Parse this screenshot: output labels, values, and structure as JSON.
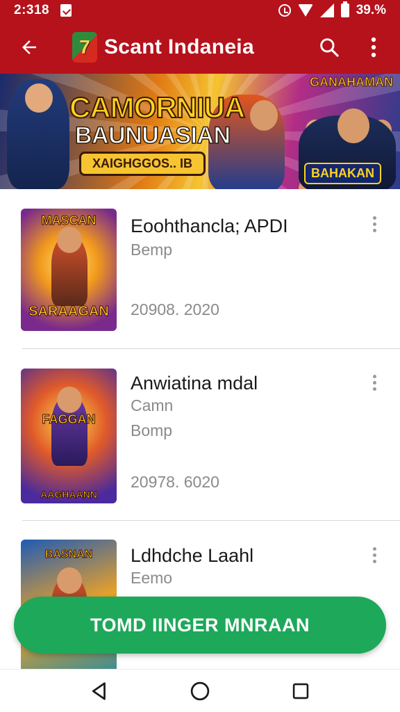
{
  "status_bar": {
    "time": "2:318",
    "battery": "39.%",
    "icons": [
      "notification-icon",
      "alarm-icon",
      "wifi-icon",
      "signal-icon",
      "battery-icon"
    ]
  },
  "app_bar": {
    "title": "Scant Indaneia",
    "logo_glyph": "7",
    "background": "#b5121b",
    "icons": [
      "back-arrow-icon",
      "search-icon",
      "more-vert-icon"
    ]
  },
  "banner": {
    "title": "CAMORNIUA",
    "subtitle": "BAUNUASIAN",
    "tag": "XAIGHGGOS.. IB",
    "logo_top": "GANAHAMAN",
    "logo_bottom": "BAHAKAN"
  },
  "items": [
    {
      "title": "Eoohthancla; APDI",
      "subtitle": "Bemp",
      "date": "20908. 2020",
      "thumb_top": "MASCAN",
      "thumb_bottom": "SARAAGAN"
    },
    {
      "title": "Anwiatina mdal",
      "subtitle": "Camn",
      "subtitle2": "Bomp",
      "date": "20978. 6020",
      "thumb_top": "FAGGAN",
      "thumb_bottom": "AAGHAANN"
    },
    {
      "title": "Ldhdche Laahl",
      "subtitle": "Eemo",
      "thumb_top": "BASNAN"
    }
  ],
  "cta": {
    "label": "TOMD IINGER MNRAAN",
    "color": "#1da85a"
  },
  "nav_bar": {
    "icons": [
      "back-triangle-icon",
      "home-circle-icon",
      "recents-square-icon"
    ]
  }
}
